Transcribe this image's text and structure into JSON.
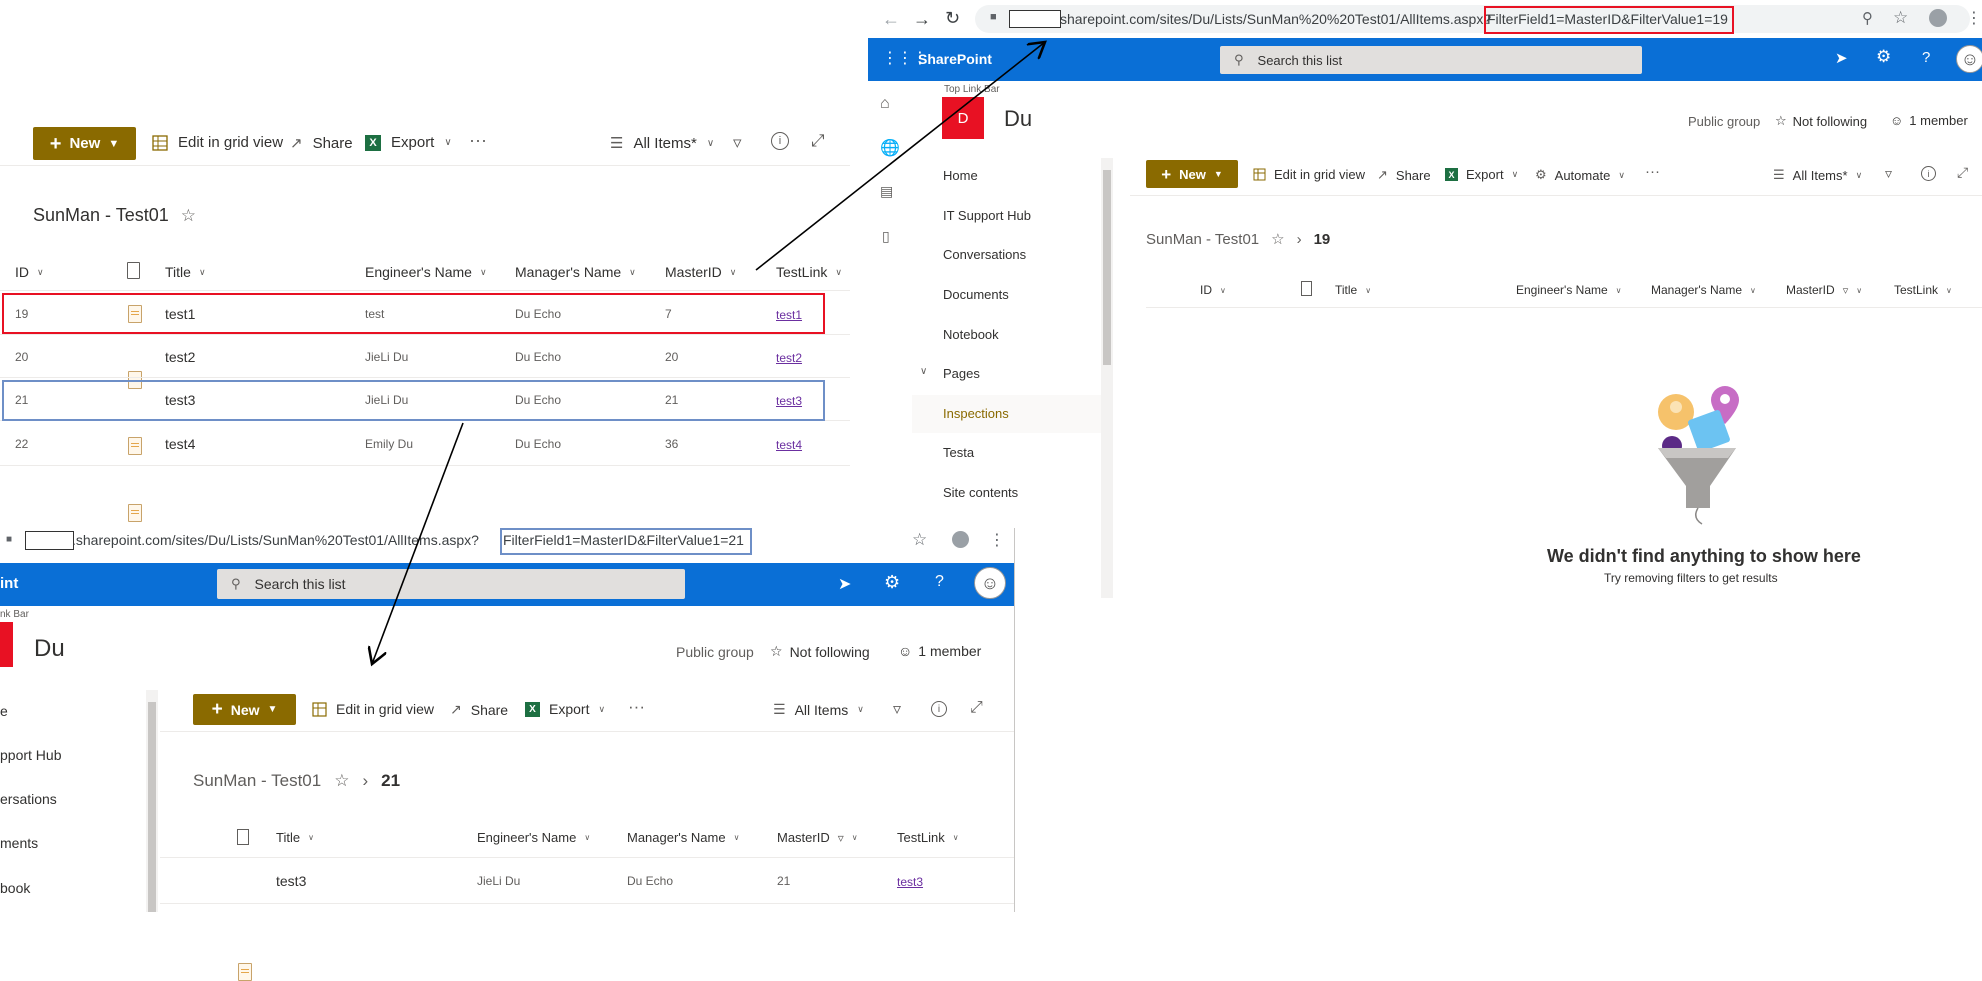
{
  "left_panel": {
    "cmdbar": {
      "new": "New",
      "edit_grid": "Edit in grid view",
      "share": "Share",
      "export": "Export",
      "more": "···",
      "view": "All Items*"
    },
    "list_title": "SunMan - Test01",
    "columns": [
      "ID",
      "Title",
      "Engineer's Name",
      "Manager's Name",
      "MasterID",
      "TestLink"
    ],
    "rows": [
      {
        "id": "19",
        "title": "test1",
        "engineer": "test",
        "manager": "Du Echo",
        "master": "7",
        "link": "test1"
      },
      {
        "id": "20",
        "title": "test2",
        "engineer": "JieLi Du",
        "manager": "Du Echo",
        "master": "20",
        "link": "test2"
      },
      {
        "id": "21",
        "title": "test3",
        "engineer": "JieLi Du",
        "manager": "Du Echo",
        "master": "21",
        "link": "test3"
      },
      {
        "id": "22",
        "title": "test4",
        "engineer": "Emily Du",
        "manager": "Du Echo",
        "master": "36",
        "link": "test4"
      }
    ]
  },
  "right_panel": {
    "url_prefix": "sharepoint.com/sites/Du/Lists/SunMan%20%20Test01/AllItems.aspx?",
    "url_filter": "FilterField1=MasterID&FilterValue1=19",
    "suite_title": "SharePoint",
    "search_placeholder": "Search this list",
    "top_link_bar": "Top Link Bar",
    "site_letter": "D",
    "site_name": "Du",
    "public_group": "Public group",
    "not_following": "Not following",
    "members": "1 member",
    "nav": [
      "Home",
      "IT Support Hub",
      "Conversations",
      "Documents",
      "Notebook",
      "Pages",
      "Inspections",
      "Testa",
      "Site contents"
    ],
    "cmdbar": {
      "new": "New",
      "edit_grid": "Edit in grid view",
      "share": "Share",
      "export": "Export",
      "automate": "Automate",
      "more": "···",
      "view": "All Items*"
    },
    "breadcrumb_list": "SunMan - Test01",
    "breadcrumb_folder": "19",
    "columns": [
      "ID",
      "Title",
      "Engineer's Name",
      "Manager's Name",
      "MasterID",
      "TestLink"
    ],
    "empty_title": "We didn't find anything to show here",
    "empty_sub": "Try removing filters to get results"
  },
  "bottom_panel": {
    "url_prefix": ".sharepoint.com/sites/Du/Lists/SunMan%20Test01/AllItems.aspx?",
    "url_filter": "FilterField1=MasterID&FilterValue1=21",
    "suite_title": "int",
    "search_placeholder": "Search this list",
    "top_link_bar": "nk Bar",
    "site_name": "Du",
    "public_group": "Public group",
    "not_following": "Not following",
    "members": "1 member",
    "nav": [
      "e",
      "pport Hub",
      "ersations",
      "ments",
      "book"
    ],
    "cmdbar": {
      "new": "New",
      "edit_grid": "Edit in grid view",
      "share": "Share",
      "export": "Export",
      "more": "···",
      "view": "All Items"
    },
    "breadcrumb_list": "SunMan - Test01",
    "breadcrumb_folder": "21",
    "columns": [
      "Title",
      "Engineer's Name",
      "Manager's Name",
      "MasterID",
      "TestLink"
    ],
    "row": {
      "title": "test3",
      "engineer": "JieLi Du",
      "manager": "Du Echo",
      "master": "21",
      "link": "test3"
    }
  },
  "colors": {
    "suite_bar": "#0a6fd6",
    "new_button": "#8a6a00",
    "highlight_red": "#e81123",
    "highlight_blue": "#6e8fc7",
    "site_logo": "#e81123",
    "link": "#6b2fa0"
  }
}
